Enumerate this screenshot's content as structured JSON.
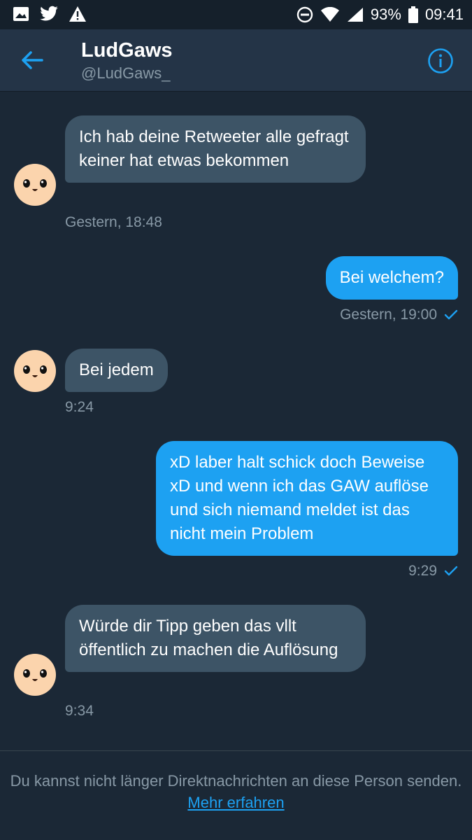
{
  "status_bar": {
    "battery": "93%",
    "time": "09:41"
  },
  "header": {
    "name": "LudGaws",
    "handle": "@LudGaws_"
  },
  "messages": [
    {
      "dir": "in",
      "text": "Ich hab deine Retweeter alle gefragt keiner hat etwas bekommen",
      "time": "Gestern, 18:48"
    },
    {
      "dir": "out",
      "text": "Bei welchem?",
      "time": "Gestern, 19:00"
    },
    {
      "dir": "in",
      "text": "Bei jedem",
      "time": "9:24"
    },
    {
      "dir": "out",
      "text": "xD laber halt schick doch Beweise xD und wenn ich das GAW auflöse und sich niemand meldet ist das nicht mein Problem",
      "time": "9:29"
    },
    {
      "dir": "in",
      "text": "Würde dir Tipp geben das vllt öffentlich zu machen die Auflösung",
      "time": "9:34"
    }
  ],
  "footer": {
    "notice": "Du kannst nicht länger Direktnachrichten an diese Person senden.",
    "link": "Mehr erfahren"
  },
  "colors": {
    "accent": "#1da1f2",
    "background": "#1b2836",
    "header": "#243447",
    "incoming": "#3d5466"
  }
}
